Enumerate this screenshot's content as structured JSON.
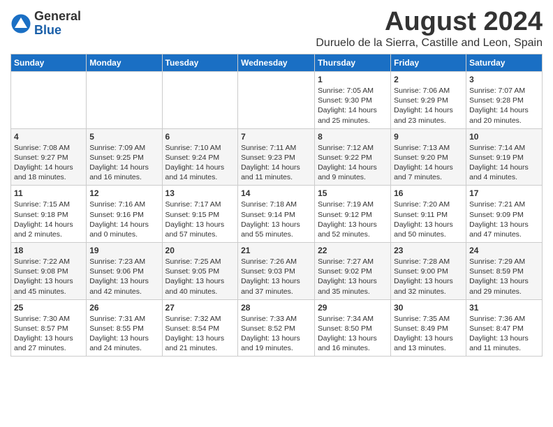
{
  "header": {
    "logo_general": "General",
    "logo_blue": "Blue",
    "main_title": "August 2024",
    "subtitle": "Duruelo de la Sierra, Castille and Leon, Spain"
  },
  "calendar": {
    "days_of_week": [
      "Sunday",
      "Monday",
      "Tuesday",
      "Wednesday",
      "Thursday",
      "Friday",
      "Saturday"
    ],
    "weeks": [
      [
        {
          "day": "",
          "content": ""
        },
        {
          "day": "",
          "content": ""
        },
        {
          "day": "",
          "content": ""
        },
        {
          "day": "",
          "content": ""
        },
        {
          "day": "1",
          "content": "Sunrise: 7:05 AM\nSunset: 9:30 PM\nDaylight: 14 hours and 25 minutes."
        },
        {
          "day": "2",
          "content": "Sunrise: 7:06 AM\nSunset: 9:29 PM\nDaylight: 14 hours and 23 minutes."
        },
        {
          "day": "3",
          "content": "Sunrise: 7:07 AM\nSunset: 9:28 PM\nDaylight: 14 hours and 20 minutes."
        }
      ],
      [
        {
          "day": "4",
          "content": "Sunrise: 7:08 AM\nSunset: 9:27 PM\nDaylight: 14 hours and 18 minutes."
        },
        {
          "day": "5",
          "content": "Sunrise: 7:09 AM\nSunset: 9:25 PM\nDaylight: 14 hours and 16 minutes."
        },
        {
          "day": "6",
          "content": "Sunrise: 7:10 AM\nSunset: 9:24 PM\nDaylight: 14 hours and 14 minutes."
        },
        {
          "day": "7",
          "content": "Sunrise: 7:11 AM\nSunset: 9:23 PM\nDaylight: 14 hours and 11 minutes."
        },
        {
          "day": "8",
          "content": "Sunrise: 7:12 AM\nSunset: 9:22 PM\nDaylight: 14 hours and 9 minutes."
        },
        {
          "day": "9",
          "content": "Sunrise: 7:13 AM\nSunset: 9:20 PM\nDaylight: 14 hours and 7 minutes."
        },
        {
          "day": "10",
          "content": "Sunrise: 7:14 AM\nSunset: 9:19 PM\nDaylight: 14 hours and 4 minutes."
        }
      ],
      [
        {
          "day": "11",
          "content": "Sunrise: 7:15 AM\nSunset: 9:18 PM\nDaylight: 14 hours and 2 minutes."
        },
        {
          "day": "12",
          "content": "Sunrise: 7:16 AM\nSunset: 9:16 PM\nDaylight: 14 hours and 0 minutes."
        },
        {
          "day": "13",
          "content": "Sunrise: 7:17 AM\nSunset: 9:15 PM\nDaylight: 13 hours and 57 minutes."
        },
        {
          "day": "14",
          "content": "Sunrise: 7:18 AM\nSunset: 9:14 PM\nDaylight: 13 hours and 55 minutes."
        },
        {
          "day": "15",
          "content": "Sunrise: 7:19 AM\nSunset: 9:12 PM\nDaylight: 13 hours and 52 minutes."
        },
        {
          "day": "16",
          "content": "Sunrise: 7:20 AM\nSunset: 9:11 PM\nDaylight: 13 hours and 50 minutes."
        },
        {
          "day": "17",
          "content": "Sunrise: 7:21 AM\nSunset: 9:09 PM\nDaylight: 13 hours and 47 minutes."
        }
      ],
      [
        {
          "day": "18",
          "content": "Sunrise: 7:22 AM\nSunset: 9:08 PM\nDaylight: 13 hours and 45 minutes."
        },
        {
          "day": "19",
          "content": "Sunrise: 7:23 AM\nSunset: 9:06 PM\nDaylight: 13 hours and 42 minutes."
        },
        {
          "day": "20",
          "content": "Sunrise: 7:25 AM\nSunset: 9:05 PM\nDaylight: 13 hours and 40 minutes."
        },
        {
          "day": "21",
          "content": "Sunrise: 7:26 AM\nSunset: 9:03 PM\nDaylight: 13 hours and 37 minutes."
        },
        {
          "day": "22",
          "content": "Sunrise: 7:27 AM\nSunset: 9:02 PM\nDaylight: 13 hours and 35 minutes."
        },
        {
          "day": "23",
          "content": "Sunrise: 7:28 AM\nSunset: 9:00 PM\nDaylight: 13 hours and 32 minutes."
        },
        {
          "day": "24",
          "content": "Sunrise: 7:29 AM\nSunset: 8:59 PM\nDaylight: 13 hours and 29 minutes."
        }
      ],
      [
        {
          "day": "25",
          "content": "Sunrise: 7:30 AM\nSunset: 8:57 PM\nDaylight: 13 hours and 27 minutes."
        },
        {
          "day": "26",
          "content": "Sunrise: 7:31 AM\nSunset: 8:55 PM\nDaylight: 13 hours and 24 minutes."
        },
        {
          "day": "27",
          "content": "Sunrise: 7:32 AM\nSunset: 8:54 PM\nDaylight: 13 hours and 21 minutes."
        },
        {
          "day": "28",
          "content": "Sunrise: 7:33 AM\nSunset: 8:52 PM\nDaylight: 13 hours and 19 minutes."
        },
        {
          "day": "29",
          "content": "Sunrise: 7:34 AM\nSunset: 8:50 PM\nDaylight: 13 hours and 16 minutes."
        },
        {
          "day": "30",
          "content": "Sunrise: 7:35 AM\nSunset: 8:49 PM\nDaylight: 13 hours and 13 minutes."
        },
        {
          "day": "31",
          "content": "Sunrise: 7:36 AM\nSunset: 8:47 PM\nDaylight: 13 hours and 11 minutes."
        }
      ]
    ]
  }
}
